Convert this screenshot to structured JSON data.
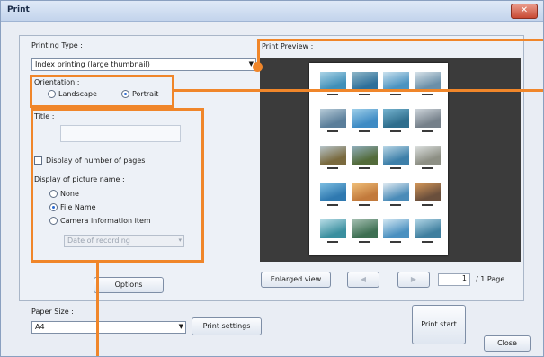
{
  "window": {
    "title": "Print"
  },
  "printing_type": {
    "label": "Printing Type :",
    "value": "Index printing (large thumbnail)"
  },
  "orientation": {
    "label": "Orientation :",
    "landscape": "Landscape",
    "portrait": "Portrait",
    "selected": "portrait"
  },
  "title_field": {
    "label": "Title :",
    "value": ""
  },
  "display_pages": {
    "label": "Display of number of pages",
    "checked": false
  },
  "picture_name": {
    "label": "Display of picture name :",
    "options": [
      "None",
      "File Name",
      "Camera information item"
    ],
    "selected": "File Name",
    "camera_item": "Date of recording"
  },
  "options_button": "Options",
  "preview": {
    "label": "Print Preview :",
    "enlarged_button": "Enlarged view",
    "page_value": "1",
    "page_total": "/ 1 Page"
  },
  "paper_size": {
    "label": "Paper Size :",
    "value": "A4",
    "settings_button": "Print settings"
  },
  "print_start_button": "Print start",
  "close_button": "Close",
  "colors": {
    "highlight": "#f0862a",
    "preview_bg": "#3b3b3b"
  }
}
